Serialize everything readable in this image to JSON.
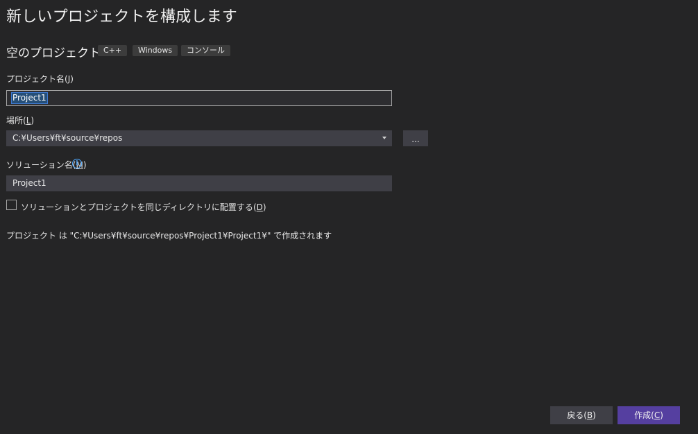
{
  "page": {
    "title": "新しいプロジェクトを構成します"
  },
  "template": {
    "name": "空のプロジェクト",
    "tags": [
      "C++",
      "Windows",
      "コンソール"
    ]
  },
  "project_name": {
    "label": "プロジェクト名",
    "mnemonic_open": "(",
    "mnemonic": "J",
    "mnemonic_close": ")",
    "value": "Project1"
  },
  "location": {
    "label": "場所",
    "mnemonic_open": "(",
    "mnemonic": "L",
    "mnemonic_close": ")",
    "value": "C:¥Users¥ft¥source¥repos",
    "browse_label": "..."
  },
  "solution_name": {
    "label": "ソリューション名",
    "mnemonic_open": "(",
    "mnemonic": "M",
    "mnemonic_close": ")",
    "info_icon": "i",
    "value": "Project1"
  },
  "same_dir": {
    "label": "ソリューションとプロジェクトを同じディレクトリに配置する",
    "mnemonic_open": "(",
    "mnemonic": "D",
    "mnemonic_close": ")",
    "checked": false
  },
  "status": {
    "text": "プロジェクト は \"C:¥Users¥ft¥source¥repos¥Project1¥Project1¥\" で作成されます"
  },
  "footer": {
    "back": {
      "label": "戻る",
      "mnemonic_open": "(",
      "mnemonic": "B",
      "mnemonic_close": ")"
    },
    "create": {
      "label": "作成",
      "mnemonic_open": "(",
      "mnemonic": "C",
      "mnemonic_close": ")"
    }
  },
  "colors": {
    "background": "#252526",
    "field": "#3f3f46",
    "accent": "#553fa0",
    "selection": "#264f78",
    "info": "#4fa8ff"
  }
}
